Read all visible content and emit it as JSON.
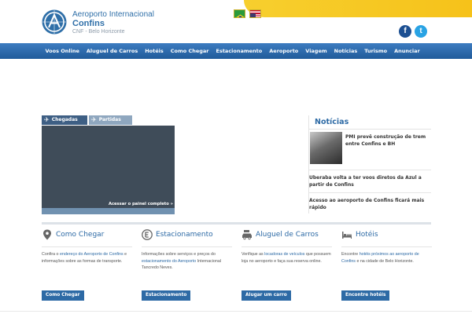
{
  "header": {
    "brand_title": "Aeroporto Internacional",
    "brand_name": "Confins",
    "brand_sub": "CNF - Belo Horizonte",
    "flags": [
      "brazil-flag",
      "usa-flag"
    ],
    "social": {
      "facebook": "f",
      "twitter": "t"
    },
    "accent_color": "#f6c21a",
    "brand_color": "#2f6fa8"
  },
  "nav": {
    "items": [
      "Voos Online",
      "Aluguel de Carros",
      "Hotéis",
      "Como Chegar",
      "Estacionamento",
      "Aeroporto",
      "Viagem",
      "Notícias",
      "Turismo",
      "Anunciar"
    ]
  },
  "flights": {
    "tabs": [
      "Chegadas",
      "Partidas"
    ],
    "panel_link": "Acessar o painel completo »"
  },
  "news": {
    "title": "Notícias",
    "items": [
      "PMI prevê construção de trem entre Confins e BH",
      "Uberaba volta a ter voos diretos da Azul a partir de Confins",
      "Acesso ao aeroporto de Confins ficará mais rápido"
    ]
  },
  "services": [
    {
      "icon": "location-pin-icon",
      "title": "Como Chegar",
      "desc": [
        "Confira o ",
        "endereço do Aeroporto de Confins",
        " e informações sobre as formas de transporte."
      ],
      "button": "Como Chegar"
    },
    {
      "icon": "parking-icon",
      "title": "Estacionamento",
      "desc": [
        "Informações sobre serviços e preços do ",
        "estacionamento do Aeroporto",
        " Internacional Tancredo Neves."
      ],
      "button": "Estacionamento"
    },
    {
      "icon": "car-icon",
      "title": "Aluguel de Carros",
      "desc": [
        "Verifique as ",
        "locadoras de veículos",
        " que possuem loja no aeroporto e faça sua reserva online."
      ],
      "button": "Alugar um carro"
    },
    {
      "icon": "bed-icon",
      "title": "Hotéis",
      "desc": [
        "Encontre ",
        "hotéis próximos ao aeroporto de Confins",
        " e na cidade de Belo Horizonte."
      ],
      "button": "Encontre hotéis"
    }
  ]
}
